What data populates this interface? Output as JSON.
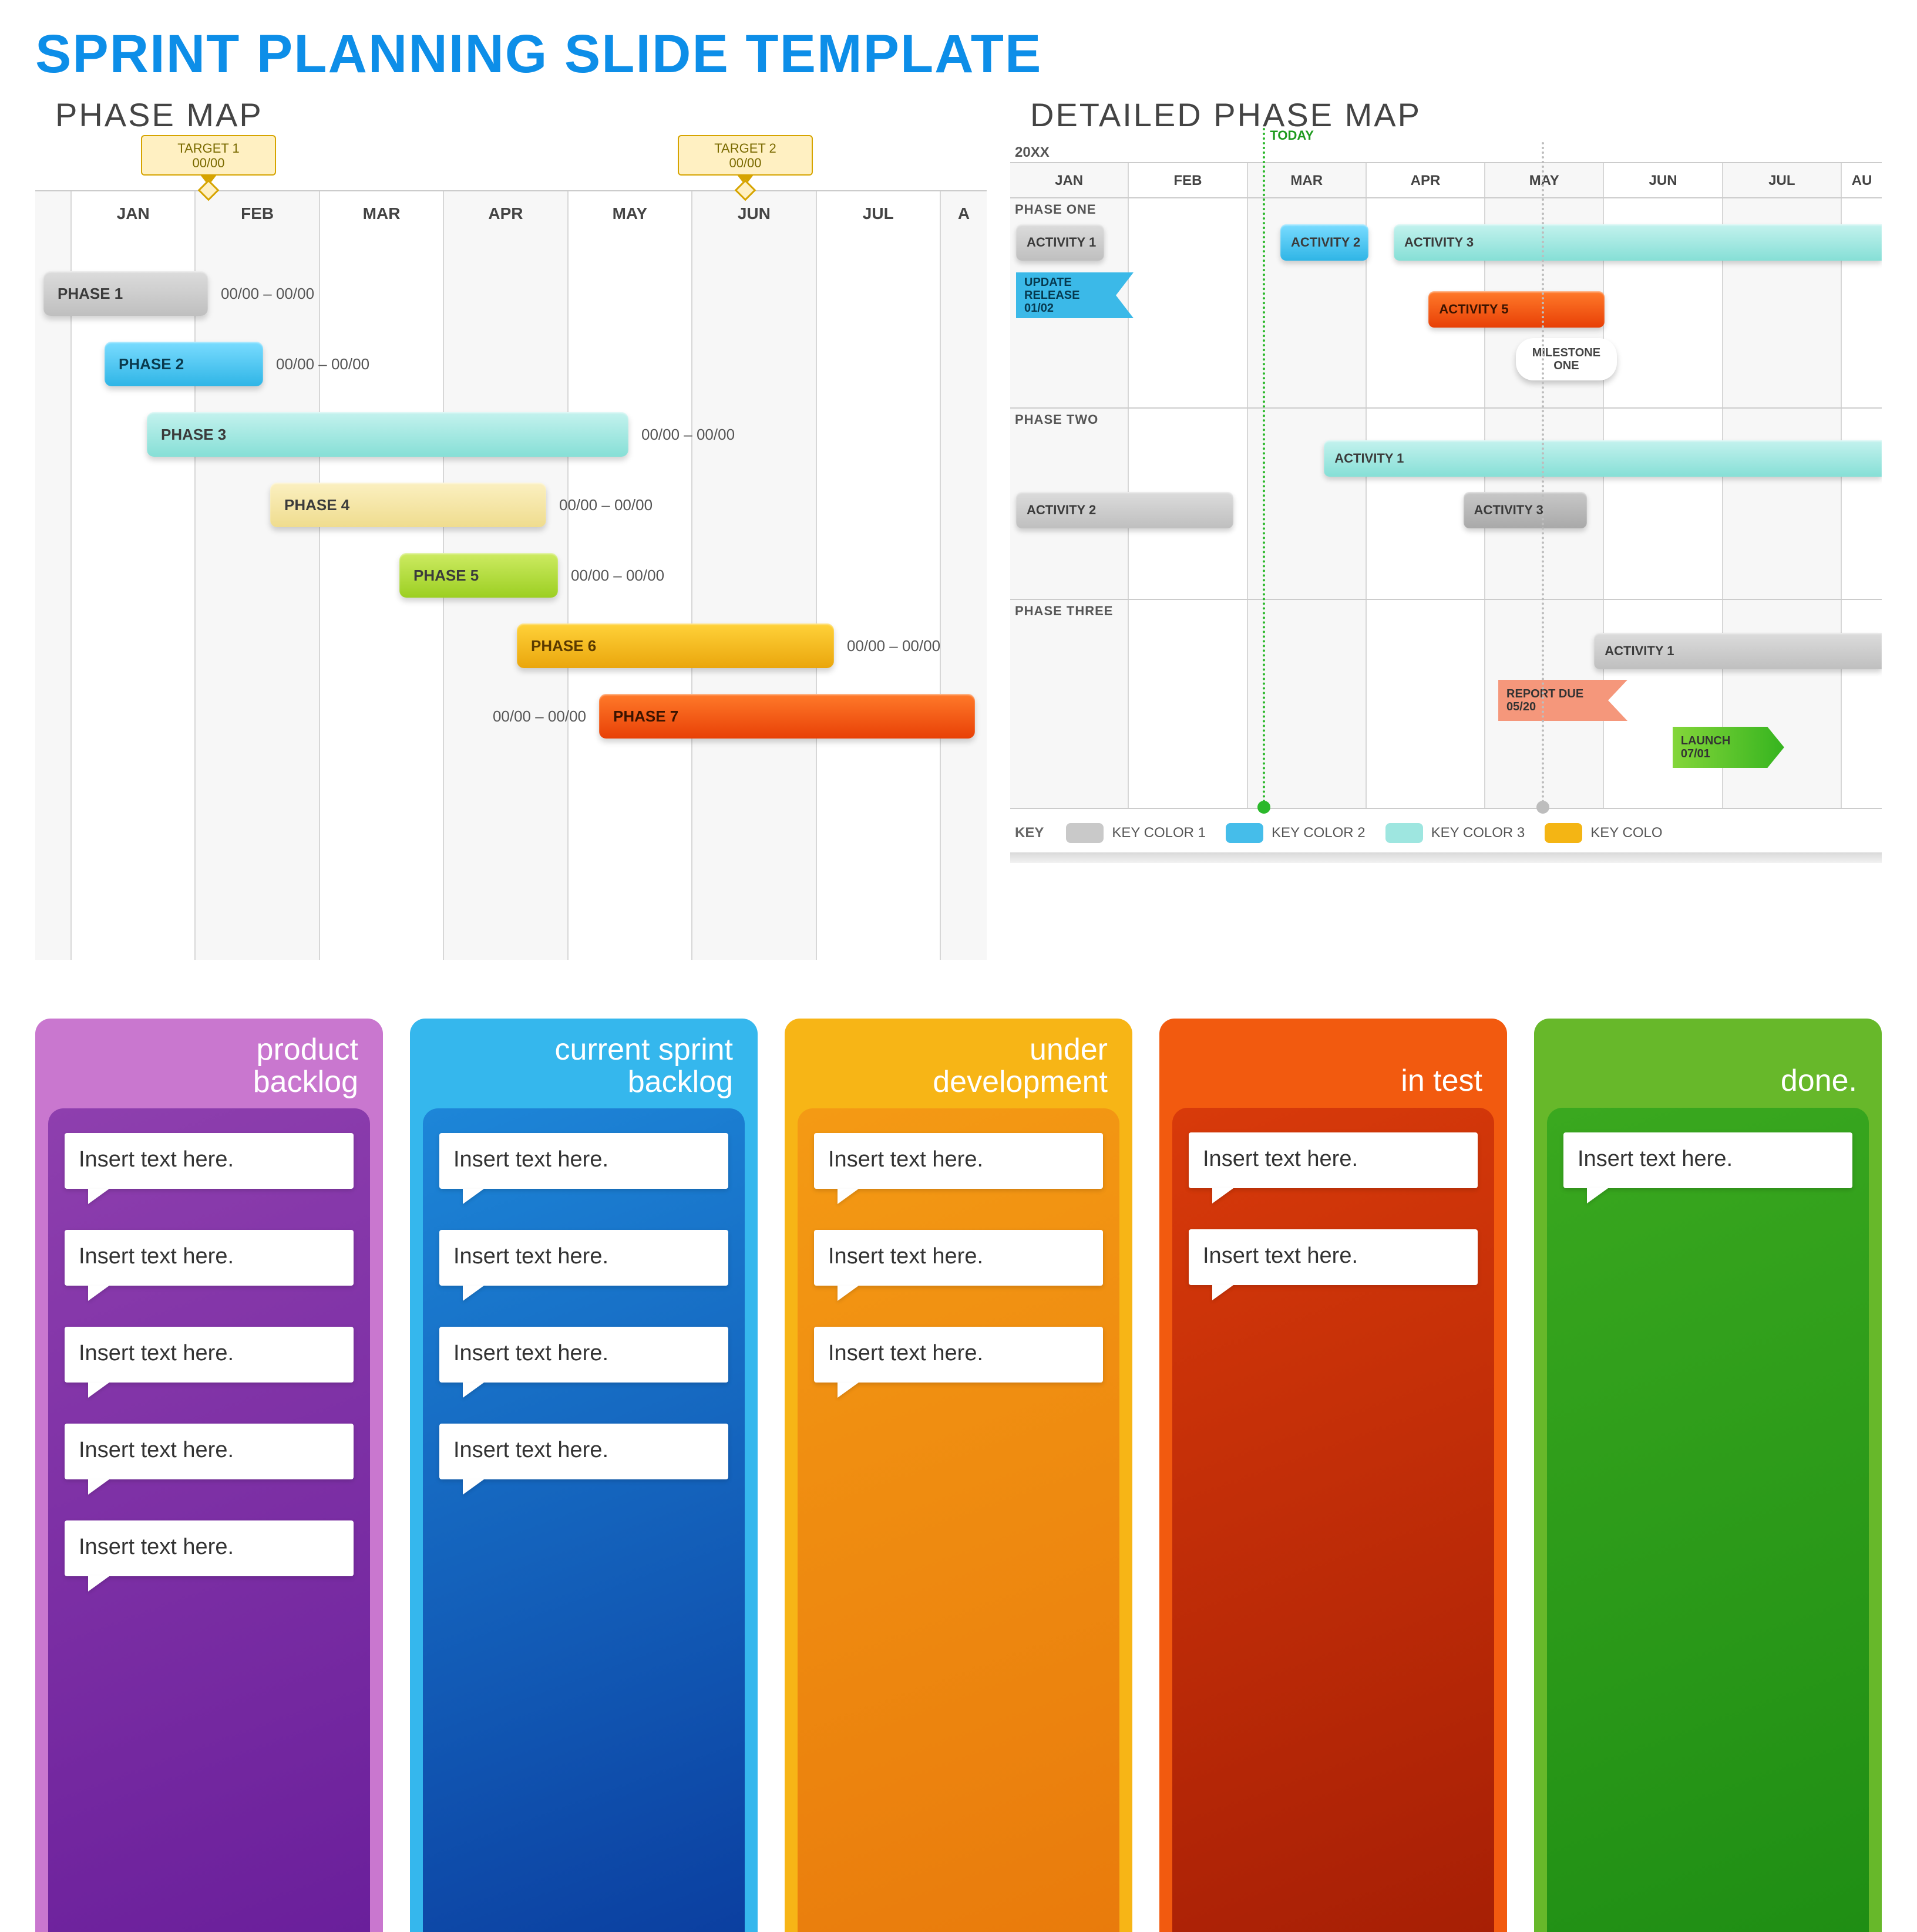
{
  "title": "SPRINT PLANNING SLIDE TEMPLATE",
  "left": {
    "heading": "PHASE MAP",
    "months": [
      "JAN",
      "FEB",
      "MAR",
      "APR",
      "MAY",
      "JUN",
      "JUL",
      "A"
    ],
    "targets": [
      {
        "name": "TARGET 1",
        "date": "00/00"
      },
      {
        "name": "TARGET 2",
        "date": "00/00"
      }
    ],
    "phases": [
      {
        "label": "PHASE 1",
        "dates": "00/00 – 00/00"
      },
      {
        "label": "PHASE 2",
        "dates": "00/00 – 00/00"
      },
      {
        "label": "PHASE 3",
        "dates": "00/00 – 00/00"
      },
      {
        "label": "PHASE 4",
        "dates": "00/00 – 00/00"
      },
      {
        "label": "PHASE 5",
        "dates": "00/00 – 00/00"
      },
      {
        "label": "PHASE 6",
        "dates": "00/00 – 00/00"
      },
      {
        "label": "PHASE 7",
        "dates": ""
      }
    ]
  },
  "right": {
    "heading": "DETAILED PHASE MAP",
    "year": "20XX",
    "today": "TODAY",
    "months": [
      "JAN",
      "FEB",
      "MAR",
      "APR",
      "MAY",
      "JUN",
      "JUL",
      "AU"
    ],
    "section1": "PHASE ONE",
    "section2": "PHASE TWO",
    "section3": "PHASE THREE",
    "act": {
      "a1": "ACTIVITY 1",
      "a2": "ACTIVITY 2",
      "a3": "ACTIVITY 3",
      "a5": "ACTIVITY 5",
      "p2a1": "ACTIVITY 1",
      "p2a2": "ACTIVITY 2",
      "p2a3": "ACTIVITY 3",
      "p3a1": "ACTIVITY 1"
    },
    "flags": {
      "update": {
        "l1": "UPDATE",
        "l2": "RELEASE",
        "l3": "01/02"
      },
      "milestone": {
        "l1": "MILESTONE",
        "l2": "ONE"
      },
      "report": {
        "l1": "REPORT DUE",
        "l2": "05/20"
      },
      "launch": {
        "l1": "LAUNCH",
        "l2": "07/01"
      }
    },
    "key": {
      "label": "KEY",
      "k1": "KEY COLOR 1",
      "k2": "KEY COLOR 2",
      "k3": "KEY COLOR 3",
      "k4": "KEY COLO"
    }
  },
  "kanban": {
    "placeholder": "Insert text here.",
    "lanes": [
      {
        "title": "product\nbacklog",
        "head": "#c977cf",
        "body1": "#8e3fae",
        "body2": "#6a1f9b",
        "cards": 5
      },
      {
        "title": "current sprint\nbacklog",
        "head": "#35b7ed",
        "body1": "#1d86d8",
        "body2": "#0b3fa0",
        "cards": 4
      },
      {
        "title": "under\ndevelopment",
        "head": "#f7b516",
        "body1": "#f49a14",
        "body2": "#e97b0c",
        "cards": 3
      },
      {
        "title": "in test",
        "head": "#f25a0f",
        "body1": "#d83a0a",
        "body2": "#a71f05",
        "cards": 2
      },
      {
        "title": "done.",
        "head": "#67b82a",
        "body1": "#3aa81f",
        "body2": "#1f8e14",
        "cards": 1
      }
    ]
  },
  "colors": {
    "grey": "#c9c9c9",
    "blue": "#45bdea",
    "teal": "#9ee6e0",
    "cream": "#f4e6a8",
    "lime": "#a8d83a",
    "amber": "#f4b514",
    "orange": "#f2540f",
    "coral": "#f59173",
    "green": "#58c322"
  }
}
